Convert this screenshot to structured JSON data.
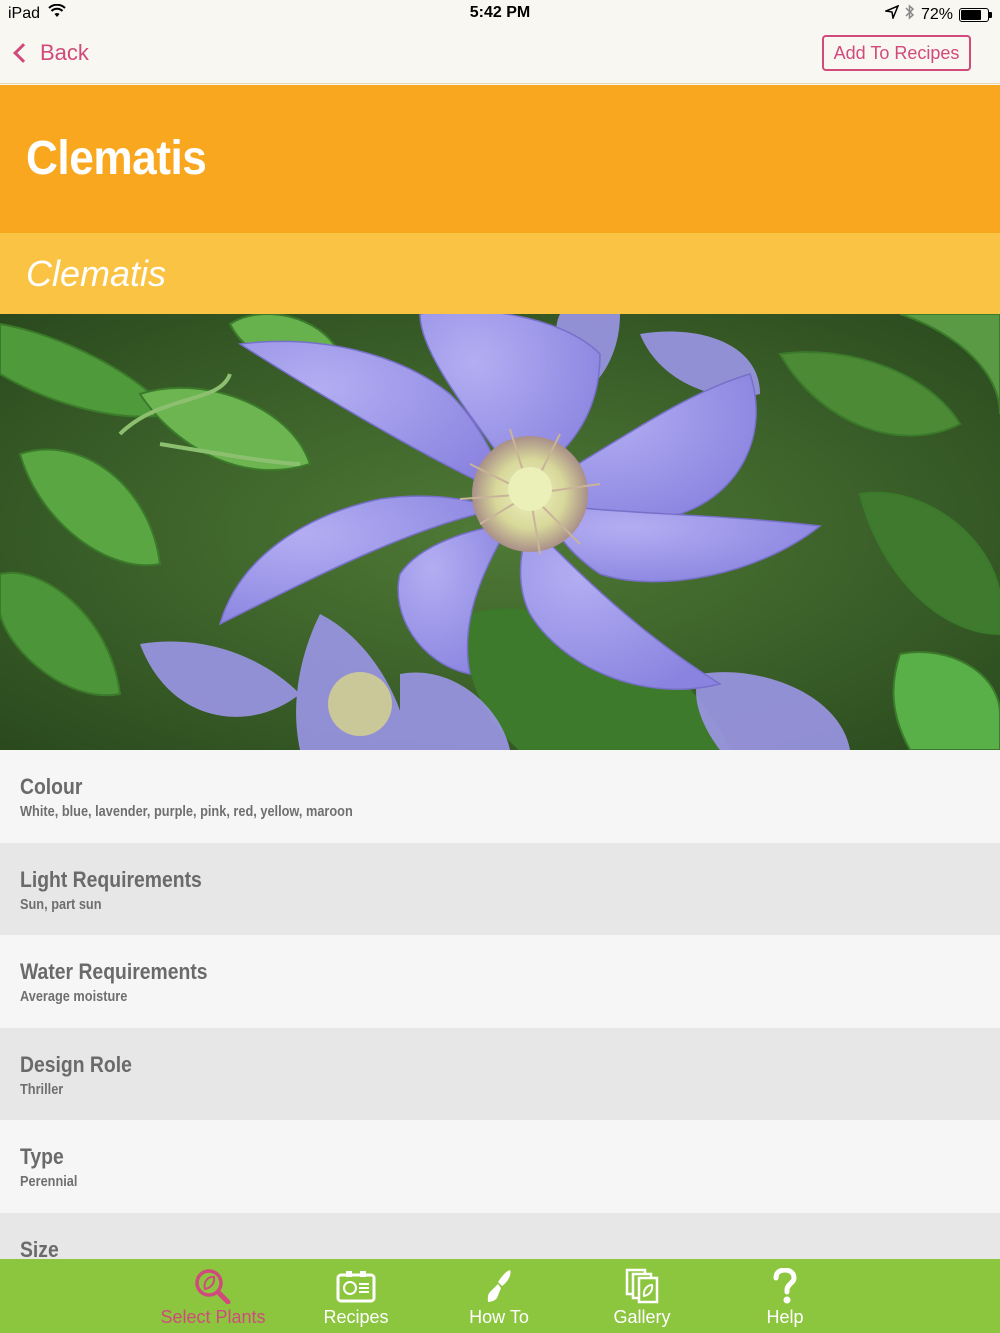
{
  "status_bar": {
    "device": "iPad",
    "time": "5:42 PM",
    "battery": "72%",
    "battery_level": 0.72
  },
  "nav": {
    "back_label": "Back",
    "add_label": "Add To Recipes"
  },
  "plant": {
    "common_name": "Clematis",
    "latin_name": "Clematis"
  },
  "details": [
    {
      "title": "Colour",
      "value": "White, blue, lavender, purple, pink, red, yellow, maroon"
    },
    {
      "title": "Light Requirements",
      "value": "Sun, part sun"
    },
    {
      "title": "Water Requirements",
      "value": "Average moisture"
    },
    {
      "title": "Design Role",
      "value": "Thriller"
    },
    {
      "title": "Type",
      "value": "Perennial"
    },
    {
      "title": "Size",
      "value": ""
    }
  ],
  "tabs": [
    {
      "label": "Select Plants",
      "icon": "magnifier-leaf-icon",
      "active": true
    },
    {
      "label": "Recipes",
      "icon": "recipe-card-icon",
      "active": false
    },
    {
      "label": "How To",
      "icon": "trowel-icon",
      "active": false
    },
    {
      "label": "Gallery",
      "icon": "gallery-icon",
      "active": false
    },
    {
      "label": "Help",
      "icon": "question-mark-icon",
      "active": false
    }
  ],
  "colors": {
    "accent": "#d14a7c",
    "title_band": "#f9a71f",
    "subtitle_band": "#fbc343",
    "tab_bar": "#8cc63f"
  }
}
